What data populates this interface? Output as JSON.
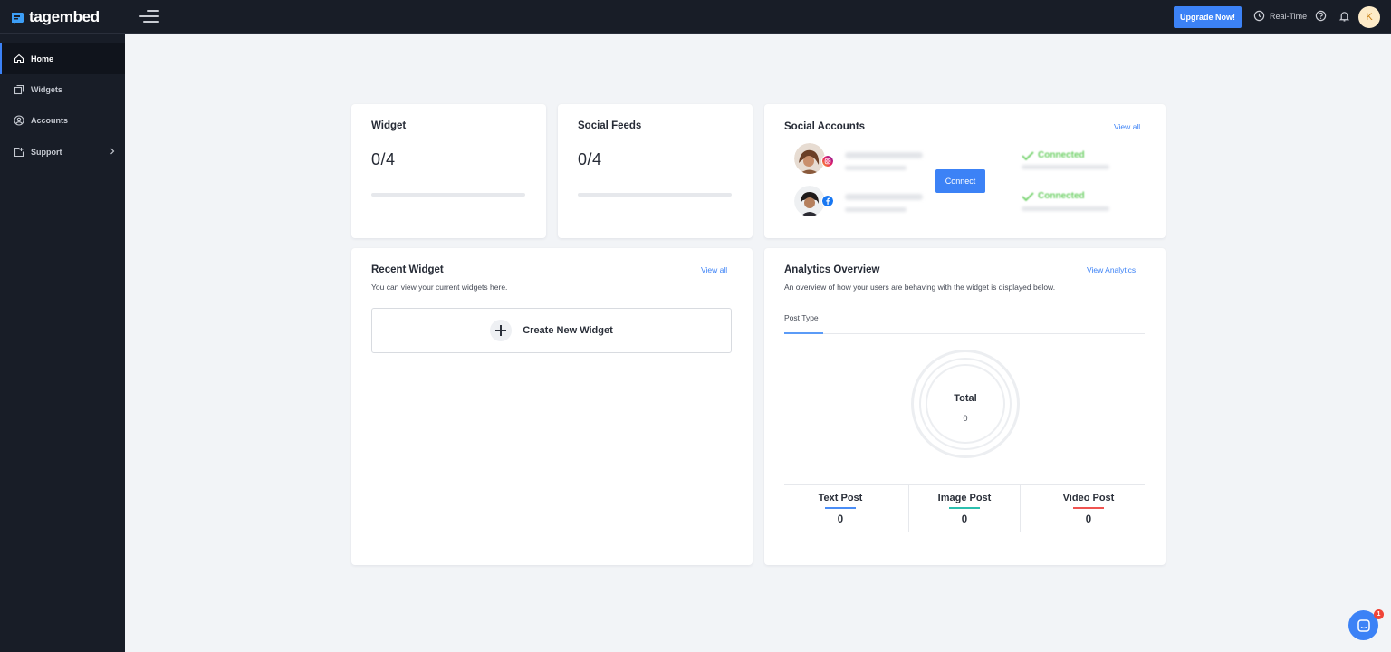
{
  "app": {
    "logo_text": "tagembed"
  },
  "header": {
    "upgrade_label": "Upgrade Now!",
    "realtime_label": "Real-Time",
    "avatar_initial": "K"
  },
  "sidebar": {
    "items": [
      {
        "label": "Home",
        "icon": "home-icon",
        "active": true
      },
      {
        "label": "Widgets",
        "icon": "widgets-icon"
      },
      {
        "label": "Accounts",
        "icon": "user-circle-icon"
      },
      {
        "label": "Support",
        "icon": "support-icon",
        "has_submenu": true
      }
    ]
  },
  "cards": {
    "widget": {
      "title": "Widget",
      "value": "0/4",
      "progress": 0
    },
    "social_feeds": {
      "title": "Social Feeds",
      "value": "0/4",
      "progress": 0
    },
    "social_accounts": {
      "title": "Social Accounts",
      "view_all": "View all",
      "connect_label": "Connect",
      "accounts": [
        {
          "network": "instagram-icon",
          "status": "Connected"
        },
        {
          "network": "facebook-icon",
          "status": "Connected"
        }
      ]
    },
    "recent_widget": {
      "title": "Recent Widget",
      "view_all": "View all",
      "description": "You can view your current widgets here.",
      "create_label": "Create New Widget"
    },
    "analytics": {
      "title": "Analytics Overview",
      "view_link": "View Analytics",
      "description": "An overview of how your users are behaving with the widget is displayed below.",
      "tab": "Post Type",
      "total_label": "Total",
      "total_value": "0",
      "stats": [
        {
          "name": "Text Post",
          "value": "0",
          "color": "#4a8df6"
        },
        {
          "name": "Image Post",
          "value": "0",
          "color": "#2bbfae"
        },
        {
          "name": "Video Post",
          "value": "0",
          "color": "#ef5350"
        }
      ]
    }
  },
  "chat": {
    "unread_count": "1"
  },
  "colors": {
    "accent": "#3c82f6",
    "sidebar_bg": "#181d27",
    "page_bg": "#f2f4f7",
    "connected": "#6bcf63"
  }
}
